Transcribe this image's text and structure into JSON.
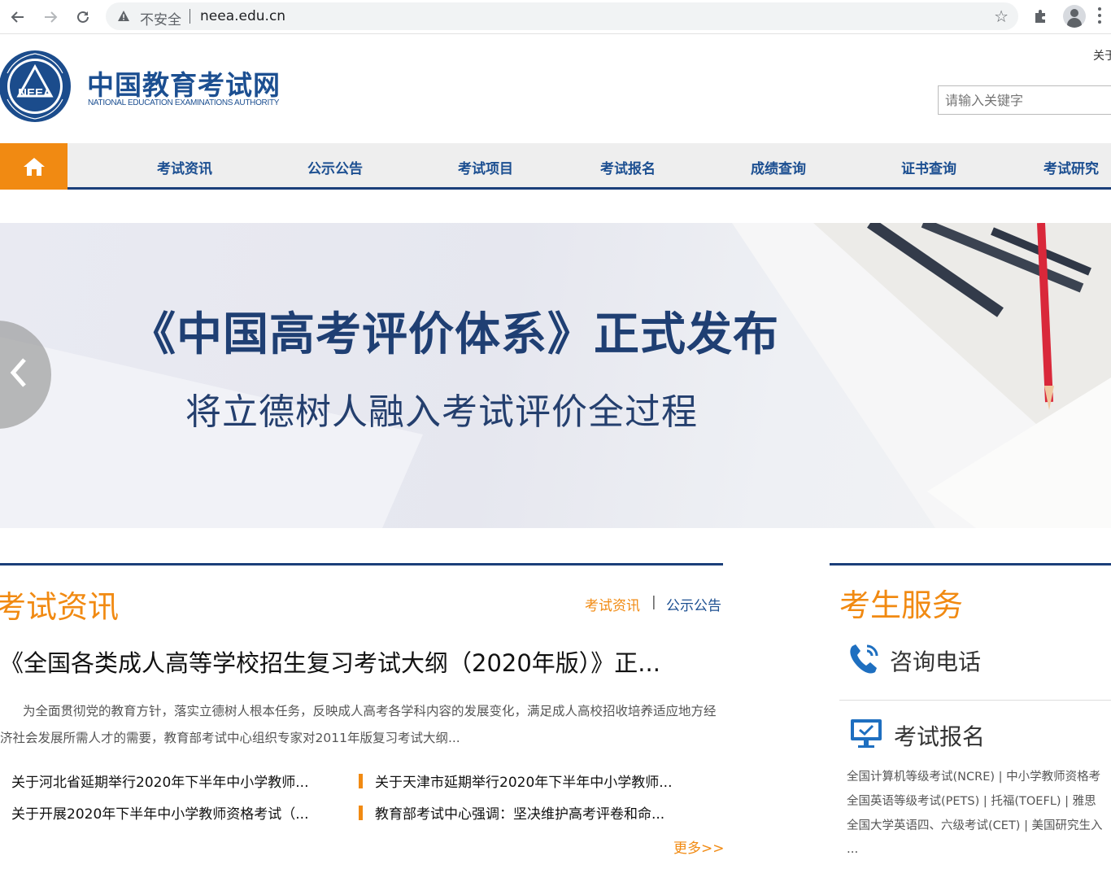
{
  "browser": {
    "security_label": "不安全",
    "url": "neea.edu.cn"
  },
  "header": {
    "logo_cn": "中国教育考试网",
    "logo_en": "NATIONAL EDUCATION EXAMINATIONS AUTHORITY",
    "logo_emblem_text": "NEEA",
    "top_link": "关于",
    "search_placeholder": "请输入关键字"
  },
  "nav": {
    "items": [
      "考试资讯",
      "公示公告",
      "考试项目",
      "考试报名",
      "成绩查询",
      "证书查询",
      "考试研究"
    ]
  },
  "banner": {
    "title": "《中国高考评价体系》正式发布",
    "subtitle": "将立德树人融入考试评价全过程"
  },
  "news": {
    "heading": "考试资讯",
    "tab_active": "考试资讯",
    "tab_sep": "|",
    "tab_other": "公示公告",
    "headline": "《全国各类成人高等学校招生复习考试大纲（2020年版）》正...",
    "summary": "为全面贯彻党的教育方针，落实立德树人根本任务，反映成人高考各学科内容的发展变化，满足成人高校招收培养适应地方经济社会发展所需人才的需要，教育部考试中心组织专家对2011年版复习考试大纲...",
    "items": [
      "关于河北省延期举行2020年下半年中小学教师...",
      "关于天津市延期举行2020年下半年中小学教师...",
      "关于开展2020年下半年中小学教师资格考试（...",
      "教育部考试中心强调：坚决维护高考评卷和命..."
    ],
    "more": "更多>>"
  },
  "service": {
    "heading": "考生服务",
    "phone_label": "咨询电话",
    "reg_label": "考试报名",
    "rows": [
      "全国计算机等级考试(NCRE)  |  中小学教师资格考",
      "全国英语等级考试(PETS)  |  托福(TOEFL)  |  雅思",
      "全国大学英语四、六级考试(CET)  |  美国研究生入"
    ],
    "more": "..."
  },
  "colors": {
    "brand_blue": "#1c4f91",
    "accent_orange": "#f18a12",
    "nav_bg": "#eeeeee"
  }
}
